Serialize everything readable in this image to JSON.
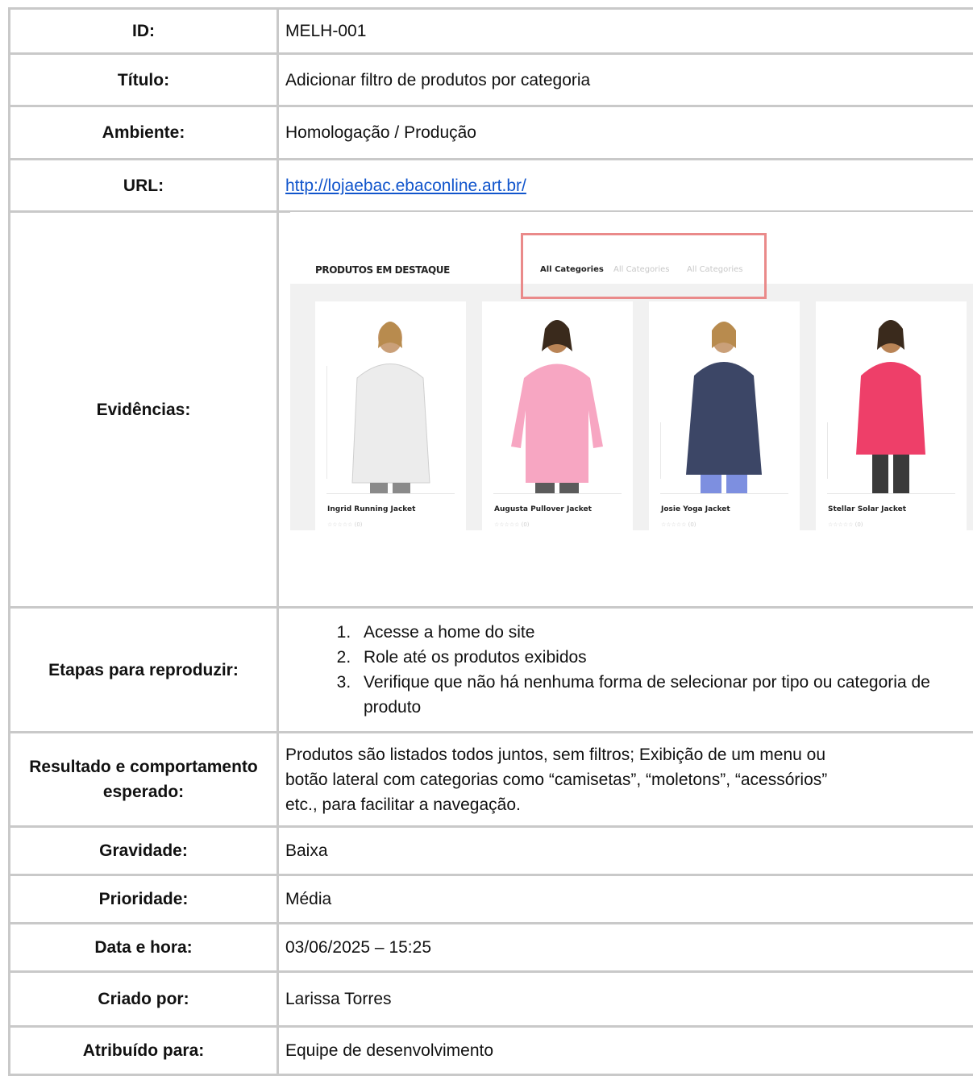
{
  "rows": {
    "id": {
      "label": "ID:",
      "value": "MELH-001"
    },
    "titulo": {
      "label": "Título:",
      "value": "Adicionar filtro de produtos por categoria"
    },
    "ambiente": {
      "label": "Ambiente:",
      "value": "Homologação / Produção"
    },
    "url": {
      "label": "URL:",
      "value": "http://lojaebac.ebaconline.art.br/"
    },
    "evidencias": {
      "label": "Evidências:"
    },
    "etapas": {
      "label": "Etapas para reproduzir:",
      "steps": [
        "Acesse a home do site",
        "Role até os produtos exibidos",
        "Verifique que não há nenhuma forma de selecionar por tipo ou categoria de produto"
      ]
    },
    "resultado": {
      "label": "Resultado e comportamento esperado:",
      "lines": [
        "Produtos são listados todos juntos, sem filtros; Exibição de um menu ou",
        "botão lateral com categorias como “camisetas”, “moletons”, “acessórios”",
        "etc., para facilitar a navegação."
      ]
    },
    "gravidade": {
      "label": "Gravidade:",
      "value": "Baixa"
    },
    "prioridade": {
      "label": "Prioridade:",
      "value": "Média"
    },
    "data": {
      "label": "Data e hora:",
      "value": "03/06/2025 – 15:25"
    },
    "criado": {
      "label": "Criado por:",
      "value": "Larissa Torres"
    },
    "atribuido": {
      "label": "Atribuído para:",
      "value": "Equipe de desenvolvimento"
    }
  },
  "evidence": {
    "section_title": "PRODUTOS EM DESTAQUE",
    "categories": [
      "All Categories",
      "All Categories",
      "All Categories"
    ],
    "highlight_color": "#ea8a8a",
    "products": [
      {
        "name": "Ingrid Running Jacket",
        "rating": "☆☆☆☆☆ (0)",
        "jacket_color": "#ececec"
      },
      {
        "name": "Augusta Pullover Jacket",
        "rating": "☆☆☆☆☆ (0)",
        "jacket_color": "#f7a6c2"
      },
      {
        "name": "Josie Yoga Jacket",
        "rating": "☆☆☆☆☆ (0)",
        "jacket_color": "#3c4666"
      },
      {
        "name": "Stellar Solar Jacket",
        "rating": "☆☆☆☆☆ (0)",
        "jacket_color": "#ee3f69"
      }
    ]
  }
}
